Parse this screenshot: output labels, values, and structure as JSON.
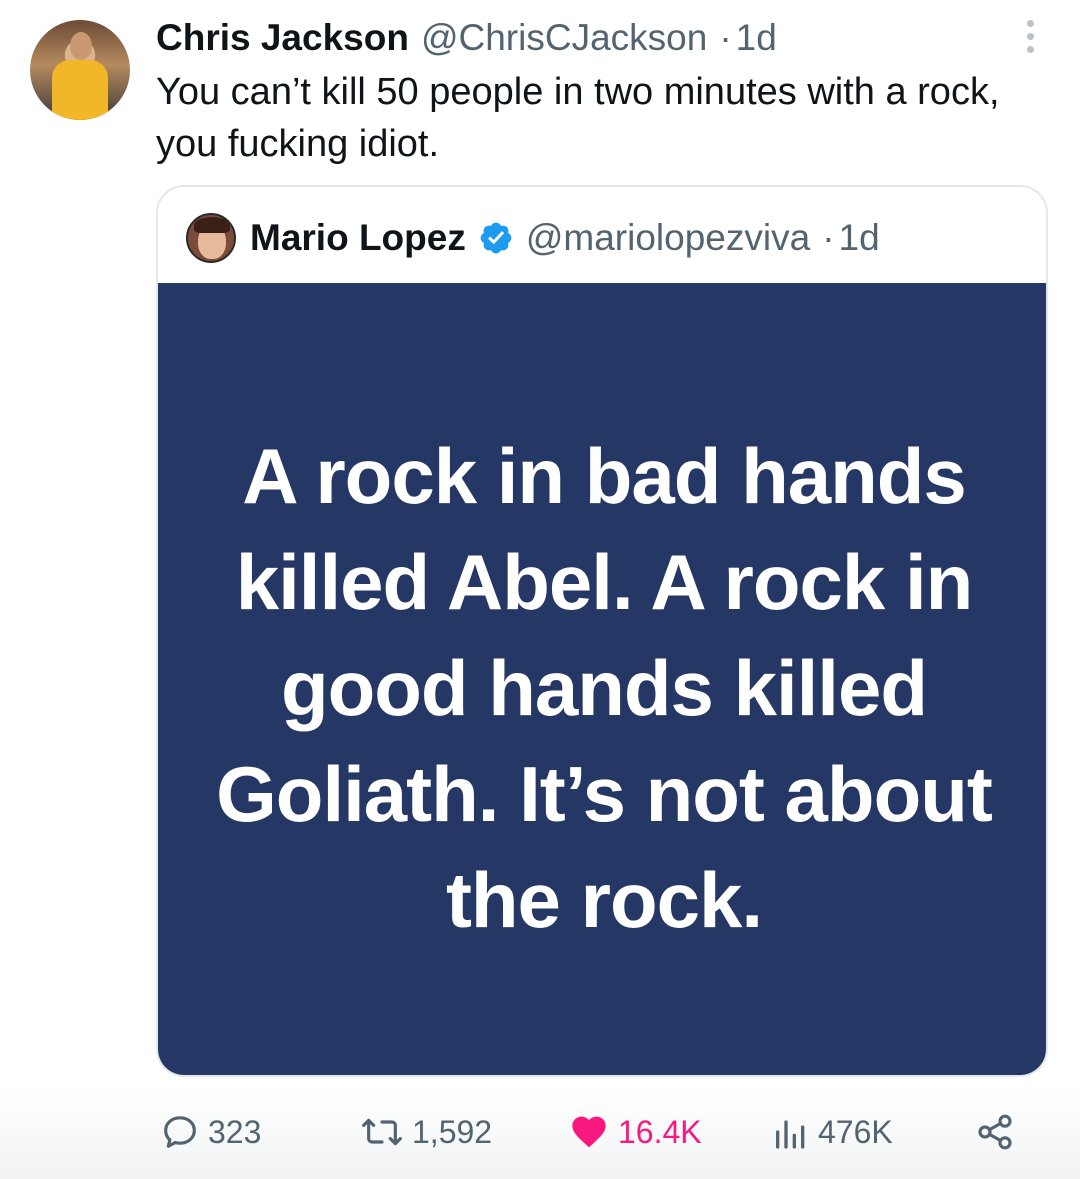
{
  "tweet": {
    "author_name": "Chris Jackson",
    "author_handle": "@ChrisCJackson",
    "separator": "·",
    "time": "1d",
    "text": "You can’t kill 50 people in two minutes with a rock, you fucking idiot."
  },
  "quoted_tweet": {
    "author_name": "Mario Lopez",
    "author_handle": "@mariolopezviva",
    "separator": "·",
    "time": "1d",
    "verified": true,
    "image_text": "A rock in bad hands killed Abel. A rock in good hands killed Goliath. It’s not about the rock.",
    "image_background": "#253764"
  },
  "actions": {
    "replies": "323",
    "retweets": "1,592",
    "likes": "16.4K",
    "views": "476K"
  },
  "colors": {
    "muted": "#536471",
    "like": "#f91880",
    "verified": "#1d9bf0"
  }
}
